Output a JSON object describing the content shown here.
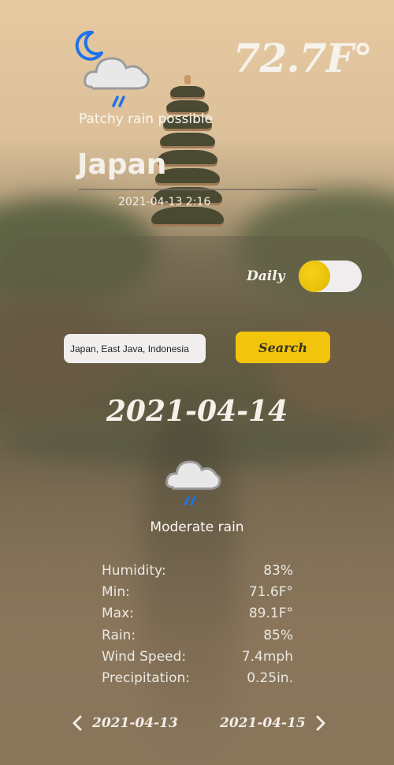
{
  "current": {
    "temperature": "72.7F°",
    "condition": "Patchy rain possible",
    "city": "Japan",
    "datetime": "2021-04-13 2:16"
  },
  "controls": {
    "toggle_label": "Daily",
    "search_value": "Japan, East Java, Indonesia",
    "search_button": "Search"
  },
  "forecast": {
    "date": "2021-04-14",
    "condition": "Moderate rain",
    "stats": [
      {
        "label": "Humidity:",
        "value": "83%"
      },
      {
        "label": "Min:",
        "value": "71.6F°"
      },
      {
        "label": "Max:",
        "value": "89.1F°"
      },
      {
        "label": "Rain:",
        "value": "85%"
      },
      {
        "label": "Wind Speed:",
        "value": "7.4mph"
      },
      {
        "label": "Precipitation:",
        "value": "0.25in."
      }
    ]
  },
  "navigation": {
    "prev_date": "2021-04-13",
    "next_date": "2021-04-15"
  },
  "icons": {
    "moon": "moon-icon",
    "cloud_rain": "cloud-rain-icon",
    "chevron_left": "chevron-left-icon",
    "chevron_right": "chevron-right-icon"
  },
  "colors": {
    "accent": "#f2c40b",
    "moon": "#1e73e8",
    "rain": "#1e73e8"
  }
}
